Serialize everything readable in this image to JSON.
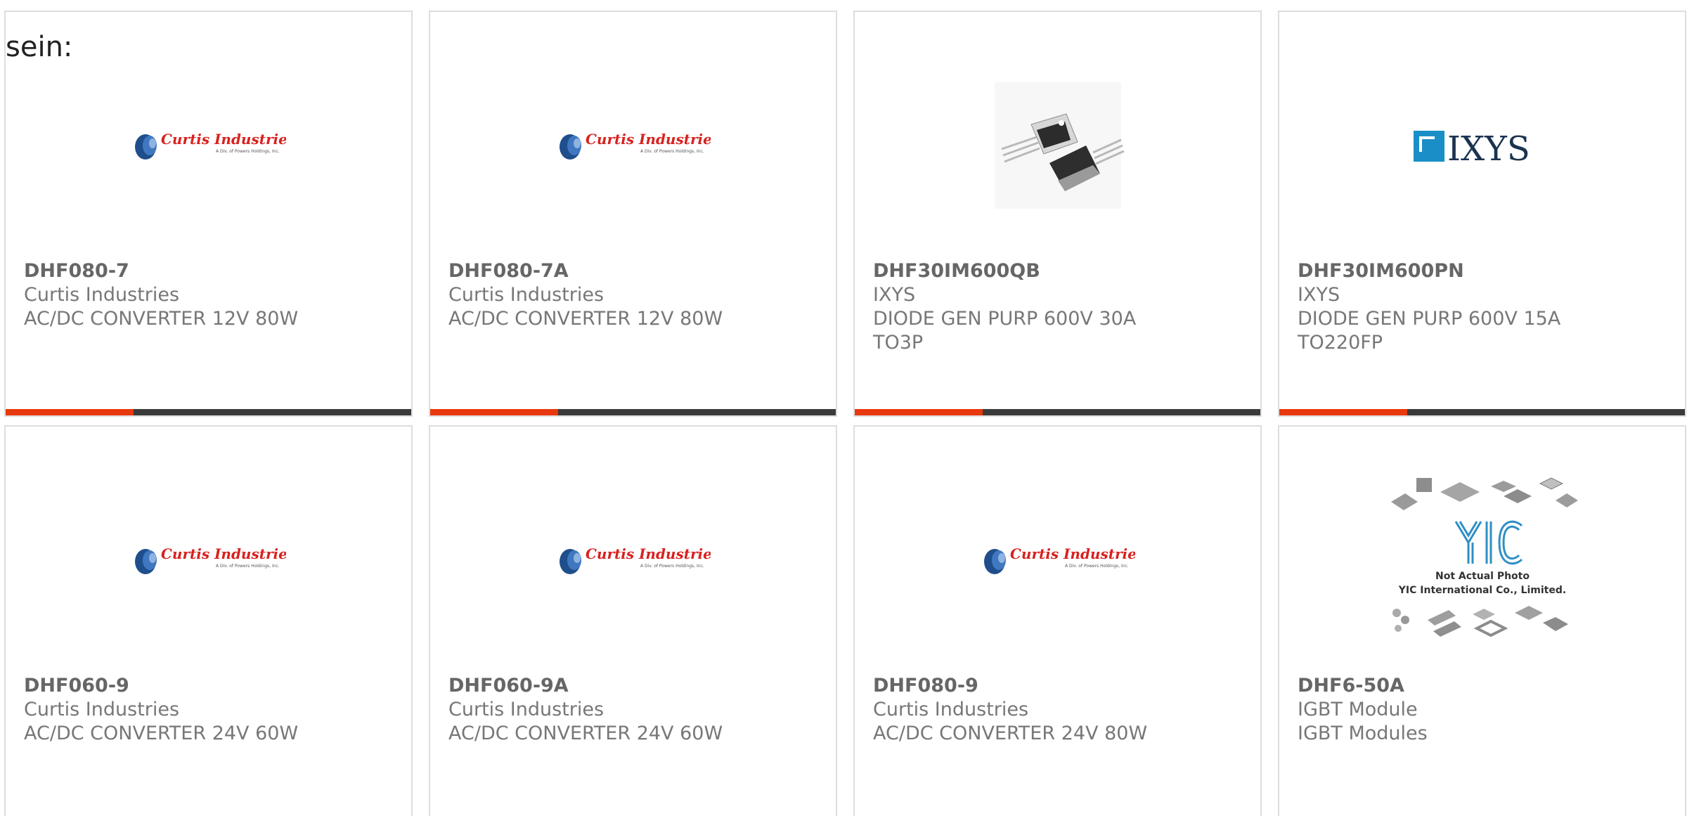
{
  "intro_text": "sein:",
  "colors": {
    "accent": "#e8380d",
    "bar": "#3a3a3a",
    "curtis_red": "#d7221f",
    "curtis_blue": "#1f4e8c",
    "ixys_blue": "#1a8fc7"
  },
  "products": [
    {
      "part": "DHF080-7",
      "maker": "Curtis Industries",
      "desc": "AC/DC CONVERTER 12V 80W",
      "desc2": "",
      "image": "curtis-logo"
    },
    {
      "part": "DHF080-7A",
      "maker": "Curtis Industries",
      "desc": "AC/DC CONVERTER 12V 80W",
      "desc2": "",
      "image": "curtis-logo"
    },
    {
      "part": "DHF30IM600QB",
      "maker": "IXYS",
      "desc": "DIODE GEN PURP 600V 30A",
      "desc2": "TO3P",
      "image": "to3p-package-photo"
    },
    {
      "part": "DHF30IM600PN",
      "maker": "IXYS",
      "desc": "DIODE GEN PURP 600V 15A",
      "desc2": "TO220FP",
      "image": "ixys-logo"
    },
    {
      "part": "DHF060-9",
      "maker": "Curtis Industries",
      "desc": "AC/DC CONVERTER 24V 60W",
      "desc2": "",
      "image": "curtis-logo"
    },
    {
      "part": "DHF060-9A",
      "maker": "Curtis Industries",
      "desc": "AC/DC CONVERTER 24V 60W",
      "desc2": "",
      "image": "curtis-logo"
    },
    {
      "part": "DHF080-9",
      "maker": "Curtis Industries",
      "desc": "AC/DC CONVERTER 24V 80W",
      "desc2": "",
      "image": "curtis-logo"
    },
    {
      "part": "DHF6-50A",
      "maker": "IGBT Module",
      "desc": "IGBT Modules",
      "desc2": "",
      "image": "yic-placeholder"
    }
  ],
  "logos": {
    "curtis_name": "Curtis Industries",
    "curtis_sub": "A Div. of Powers Holdings, Inc.",
    "ixys": "IXYS",
    "yic_mark": "YIC",
    "yic_line1": "Not Actual Photo",
    "yic_line2": "YIC International Co., Limited."
  }
}
